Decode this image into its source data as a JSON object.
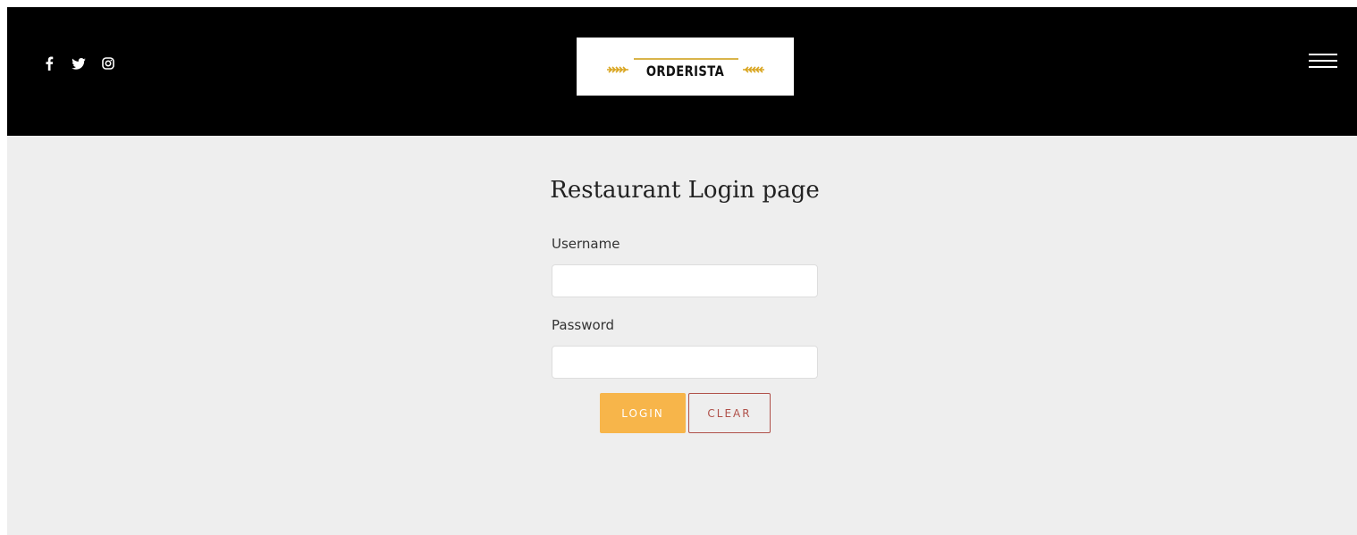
{
  "header": {
    "social": [
      {
        "name": "facebook-icon",
        "glyph": "f"
      },
      {
        "name": "twitter-icon",
        "glyph": "twitter"
      },
      {
        "name": "instagram-icon",
        "glyph": "instagram"
      }
    ],
    "logo_text": "ORDERISTA",
    "menu_icon": "hamburger-menu-icon"
  },
  "main": {
    "title": "Restaurant Login page",
    "username_label": "Username",
    "username_value": "",
    "password_label": "Password",
    "password_value": "",
    "login_label": "LOGIN",
    "clear_label": "CLEAR"
  },
  "colors": {
    "header_bg": "#000000",
    "page_bg": "#eeeeee",
    "login_button": "#f7b54a",
    "clear_button_border": "#b0514a",
    "logo_accent": "#d9b44a"
  }
}
